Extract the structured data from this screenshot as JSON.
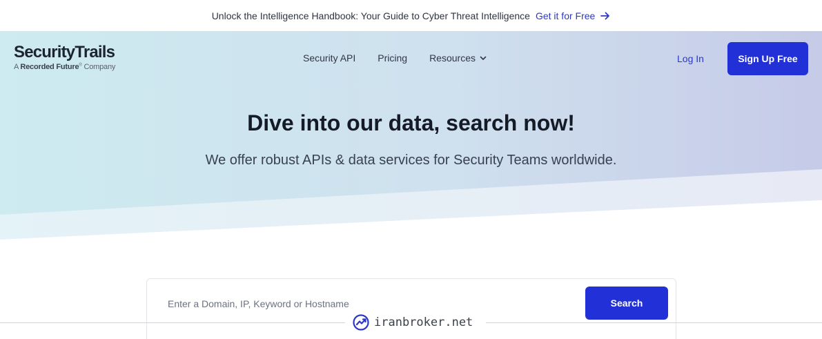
{
  "announcement": {
    "text": "Unlock the Intelligence Handbook: Your Guide to Cyber Threat Intelligence",
    "cta_label": "Get it for Free"
  },
  "logo": {
    "name": "SecurityTrails",
    "sub_prefix": "A ",
    "sub_brand": "Recorded Future",
    "sub_mark": "®",
    "sub_suffix": " Company"
  },
  "nav": {
    "items": [
      {
        "label": "Security API"
      },
      {
        "label": "Pricing"
      },
      {
        "label": "Resources"
      }
    ],
    "login_label": "Log In",
    "signup_label": "Sign Up Free"
  },
  "hero": {
    "title": "Dive into our data, search now!",
    "tagline": "We offer robust APIs & data services for Security Teams worldwide."
  },
  "search": {
    "placeholder": "Enter a Domain, IP, Keyword or Hostname",
    "button_label": "Search"
  },
  "watermark": {
    "text": "iranbroker.net"
  },
  "colors": {
    "accent": "#2230d8",
    "link": "#2b37c9",
    "hero_left": "#cdebf0",
    "hero_right": "#c6cbe8"
  },
  "icons": {
    "cta": "arrow-right-icon",
    "resources": "chevron-down-icon",
    "watermark": "trend-chart-icon"
  }
}
